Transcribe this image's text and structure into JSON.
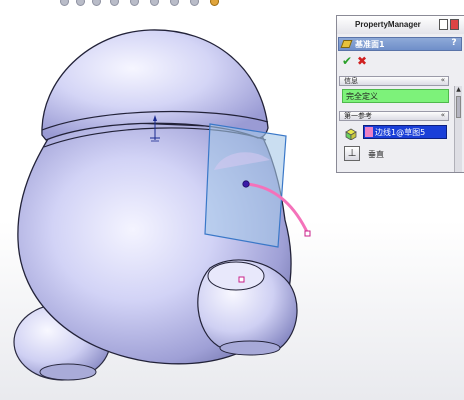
{
  "property_manager": {
    "title": "PropertyManager",
    "feature_name": "基准面1",
    "help_label": "?",
    "ok_label": "✔",
    "cancel_label": "✖",
    "collapse_label": "«",
    "sections": {
      "message": {
        "title": "信息",
        "status_text": "完全定义"
      },
      "first_reference": {
        "title": "第一参考",
        "selection_text": "边线1@草图5",
        "constraint_label": "垂直",
        "constraint_icon": "perpendicular-icon"
      }
    }
  },
  "viewport": {
    "toolbar_icons": [
      "zoom-to-fit-icon",
      "zoom-area-icon",
      "previous-view-icon",
      "section-view-icon",
      "view-orientation-icon",
      "display-style-icon",
      "hide-show-icon",
      "edit-appearance-icon",
      "apply-scene-icon"
    ],
    "colors": {
      "model_body": "#c9caf4",
      "plane_fill": "#a6c8e8",
      "sketch_curve": "#f472ba"
    }
  }
}
